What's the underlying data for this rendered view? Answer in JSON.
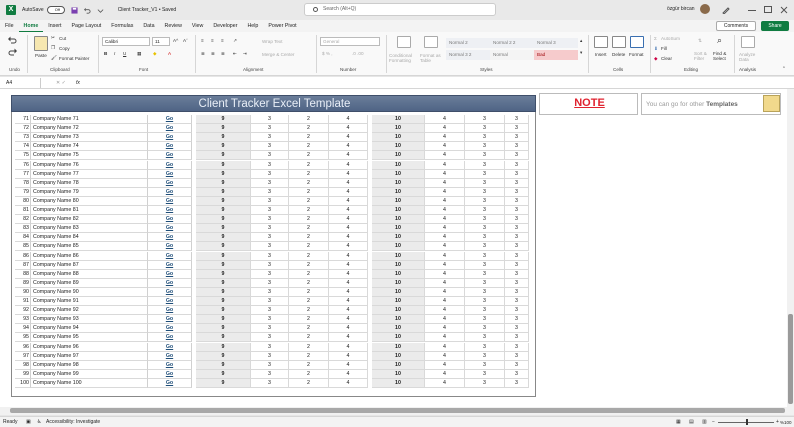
{
  "titlebar": {
    "autosave_label": "AutoSave",
    "autosave_state": "Off",
    "filename": "Client Tracker_V1 • Saved",
    "search_placeholder": "Search (Alt+Q)",
    "user_name": "özgür bircan"
  },
  "menu": {
    "tabs": [
      "File",
      "Home",
      "Insert",
      "Page Layout",
      "Formulas",
      "Data",
      "Review",
      "View",
      "Developer",
      "Help",
      "Power Pivot"
    ],
    "active": "Home",
    "comments_label": "Comments",
    "share_label": "Share"
  },
  "ribbon": {
    "undo_group": "Undo",
    "clipboard": {
      "label": "Clipboard",
      "paste": "Paste",
      "cut": "Cut",
      "copy": "Copy",
      "format_painter": "Format Painter"
    },
    "font": {
      "label": "Font",
      "name": "Calibri",
      "size": "11",
      "bold": "B",
      "italic": "I",
      "underline": "U"
    },
    "alignment": {
      "label": "Alignment",
      "wrap_text": "Wrap Text",
      "merge_center": "Merge & Center"
    },
    "number": {
      "label": "Number",
      "format": "General"
    },
    "styles": {
      "label": "Styles",
      "conditional_formatting": "Conditional Formatting",
      "format_as_table": "Format as Table",
      "cells": [
        "Normal 2",
        "Normal 2 2",
        "Normal 3",
        "Normal 3 2",
        "Normal",
        "Bad"
      ]
    },
    "cells": {
      "label": "Cells",
      "insert": "Insert",
      "delete": "Delete",
      "format": "Format"
    },
    "editing": {
      "label": "Editing",
      "autosum": "AutoSum",
      "fill": "Fill",
      "clear": "Clear",
      "sort_filter": "Sort & Filter",
      "find_select": "Find & Select"
    },
    "analysis": {
      "label": "Analysis",
      "analyze_data": "Analyze Data"
    }
  },
  "formula_bar": {
    "name_box": "A4",
    "fx": "fx",
    "content": ""
  },
  "sheet": {
    "header_title": "Client Tracker Excel Template",
    "note_label": "NOTE",
    "tip_text_prefix": "You can go for other",
    "tip_text_bold": "Templates",
    "go_label": "Go",
    "rows": [
      {
        "num": "71",
        "name": "Company Name 71",
        "q": "9",
        "a": "3",
        "b": "2",
        "c": "4",
        "total": "10",
        "d": "4",
        "e": "3",
        "f": "3"
      },
      {
        "num": "72",
        "name": "Company Name 72",
        "q": "9",
        "a": "3",
        "b": "2",
        "c": "4",
        "total": "10",
        "d": "4",
        "e": "3",
        "f": "3"
      },
      {
        "num": "73",
        "name": "Company Name 73",
        "q": "9",
        "a": "3",
        "b": "2",
        "c": "4",
        "total": "10",
        "d": "4",
        "e": "3",
        "f": "3"
      },
      {
        "num": "74",
        "name": "Company Name 74",
        "q": "9",
        "a": "3",
        "b": "2",
        "c": "4",
        "total": "10",
        "d": "4",
        "e": "3",
        "f": "3"
      },
      {
        "num": "75",
        "name": "Company Name 75",
        "q": "9",
        "a": "3",
        "b": "2",
        "c": "4",
        "total": "10",
        "d": "4",
        "e": "3",
        "f": "3"
      },
      {
        "num": "76",
        "name": "Company Name 76",
        "q": "9",
        "a": "3",
        "b": "2",
        "c": "4",
        "total": "10",
        "d": "4",
        "e": "3",
        "f": "3"
      },
      {
        "num": "77",
        "name": "Company Name 77",
        "q": "9",
        "a": "3",
        "b": "2",
        "c": "4",
        "total": "10",
        "d": "4",
        "e": "3",
        "f": "3"
      },
      {
        "num": "78",
        "name": "Company Name 78",
        "q": "9",
        "a": "3",
        "b": "2",
        "c": "4",
        "total": "10",
        "d": "4",
        "e": "3",
        "f": "3"
      },
      {
        "num": "79",
        "name": "Company Name 79",
        "q": "9",
        "a": "3",
        "b": "2",
        "c": "4",
        "total": "10",
        "d": "4",
        "e": "3",
        "f": "3"
      },
      {
        "num": "80",
        "name": "Company Name 80",
        "q": "9",
        "a": "3",
        "b": "2",
        "c": "4",
        "total": "10",
        "d": "4",
        "e": "3",
        "f": "3"
      },
      {
        "num": "81",
        "name": "Company Name 81",
        "q": "9",
        "a": "3",
        "b": "2",
        "c": "4",
        "total": "10",
        "d": "4",
        "e": "3",
        "f": "3"
      },
      {
        "num": "82",
        "name": "Company Name 82",
        "q": "9",
        "a": "3",
        "b": "2",
        "c": "4",
        "total": "10",
        "d": "4",
        "e": "3",
        "f": "3"
      },
      {
        "num": "83",
        "name": "Company Name 83",
        "q": "9",
        "a": "3",
        "b": "2",
        "c": "4",
        "total": "10",
        "d": "4",
        "e": "3",
        "f": "3"
      },
      {
        "num": "84",
        "name": "Company Name 84",
        "q": "9",
        "a": "3",
        "b": "2",
        "c": "4",
        "total": "10",
        "d": "4",
        "e": "3",
        "f": "3"
      },
      {
        "num": "85",
        "name": "Company Name 85",
        "q": "9",
        "a": "3",
        "b": "2",
        "c": "4",
        "total": "10",
        "d": "4",
        "e": "3",
        "f": "3"
      },
      {
        "num": "86",
        "name": "Company Name 86",
        "q": "9",
        "a": "3",
        "b": "2",
        "c": "4",
        "total": "10",
        "d": "4",
        "e": "3",
        "f": "3"
      },
      {
        "num": "87",
        "name": "Company Name 87",
        "q": "9",
        "a": "3",
        "b": "2",
        "c": "4",
        "total": "10",
        "d": "4",
        "e": "3",
        "f": "3"
      },
      {
        "num": "88",
        "name": "Company Name 88",
        "q": "9",
        "a": "3",
        "b": "2",
        "c": "4",
        "total": "10",
        "d": "4",
        "e": "3",
        "f": "3"
      },
      {
        "num": "89",
        "name": "Company Name 89",
        "q": "9",
        "a": "3",
        "b": "2",
        "c": "4",
        "total": "10",
        "d": "4",
        "e": "3",
        "f": "3"
      },
      {
        "num": "90",
        "name": "Company Name 90",
        "q": "9",
        "a": "3",
        "b": "2",
        "c": "4",
        "total": "10",
        "d": "4",
        "e": "3",
        "f": "3"
      },
      {
        "num": "91",
        "name": "Company Name 91",
        "q": "9",
        "a": "3",
        "b": "2",
        "c": "4",
        "total": "10",
        "d": "4",
        "e": "3",
        "f": "3"
      },
      {
        "num": "92",
        "name": "Company Name 92",
        "q": "9",
        "a": "3",
        "b": "2",
        "c": "4",
        "total": "10",
        "d": "4",
        "e": "3",
        "f": "3"
      },
      {
        "num": "93",
        "name": "Company Name 93",
        "q": "9",
        "a": "3",
        "b": "2",
        "c": "4",
        "total": "10",
        "d": "4",
        "e": "3",
        "f": "3"
      },
      {
        "num": "94",
        "name": "Company Name 94",
        "q": "9",
        "a": "3",
        "b": "2",
        "c": "4",
        "total": "10",
        "d": "4",
        "e": "3",
        "f": "3"
      },
      {
        "num": "95",
        "name": "Company Name 95",
        "q": "9",
        "a": "3",
        "b": "2",
        "c": "4",
        "total": "10",
        "d": "4",
        "e": "3",
        "f": "3"
      },
      {
        "num": "96",
        "name": "Company Name 96",
        "q": "9",
        "a": "3",
        "b": "2",
        "c": "4",
        "total": "10",
        "d": "4",
        "e": "3",
        "f": "3"
      },
      {
        "num": "97",
        "name": "Company Name 97",
        "q": "9",
        "a": "3",
        "b": "2",
        "c": "4",
        "total": "10",
        "d": "4",
        "e": "3",
        "f": "3"
      },
      {
        "num": "98",
        "name": "Company Name 98",
        "q": "9",
        "a": "3",
        "b": "2",
        "c": "4",
        "total": "10",
        "d": "4",
        "e": "3",
        "f": "3"
      },
      {
        "num": "99",
        "name": "Company Name 99",
        "q": "9",
        "a": "3",
        "b": "2",
        "c": "4",
        "total": "10",
        "d": "4",
        "e": "3",
        "f": "3"
      },
      {
        "num": "100",
        "name": "Company Name 100",
        "q": "9",
        "a": "3",
        "b": "2",
        "c": "4",
        "total": "10",
        "d": "4",
        "e": "3",
        "f": "3"
      }
    ]
  },
  "statusbar": {
    "ready": "Ready",
    "accessibility": "Accessibility: Investigate",
    "zoom": "%100"
  },
  "colors": {
    "excel_green": "#107c41",
    "header_band": "#5a6e8f",
    "note_red": "#e0222f",
    "go_link": "#1f4e79"
  }
}
